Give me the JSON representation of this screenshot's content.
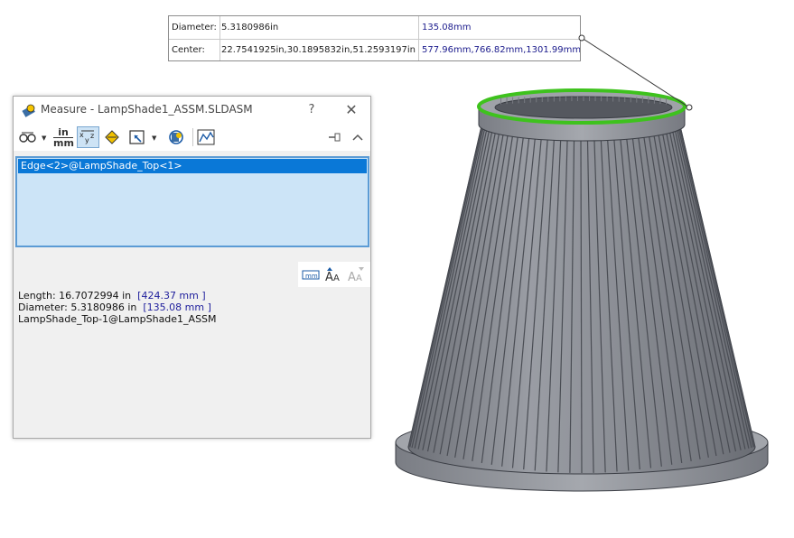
{
  "callout": {
    "rows": [
      {
        "label": "Diameter:",
        "value_in": "5.3180986in",
        "value_mm": "135.08mm"
      },
      {
        "label": "Center:",
        "value_in": "22.7541925in,30.1895832in,51.2593197in",
        "value_mm": "577.96mm,766.82mm,1301.99mm"
      }
    ]
  },
  "dialog": {
    "title": "Measure - LampShade1_ASSM.SLDASM",
    "help": "?",
    "close": "✕",
    "toolbar": {
      "units_top": "in",
      "units_bottom": "mm"
    },
    "selection": [
      "Edge<2>@LampShade_Top<1>"
    ],
    "results": {
      "length_label": "Length: 16.7072994 in",
      "length_mm": "[424.37 mm ]",
      "diameter_label": "Diameter: 5.3180986 in",
      "diameter_mm": "[135.08 mm ]",
      "component": "LampShade_Top-1@LampShade1_ASSM"
    }
  },
  "colors": {
    "selected_edge": "#3ec21d",
    "model_fill": "#8e9198",
    "model_edge": "#3a3d44",
    "mm_text": "#1e1e9c",
    "selection_bg": "#0a78d7"
  },
  "icons": [
    "measure-icon",
    "arc-circle-icon",
    "units-icon",
    "xyz-icon",
    "point-to-point-icon",
    "projection-icon",
    "sensor-icon",
    "history-icon",
    "pin-icon",
    "collapse-icon",
    "dual-dimension-icon",
    "text-size-increase-icon",
    "text-size-decrease-icon"
  ]
}
